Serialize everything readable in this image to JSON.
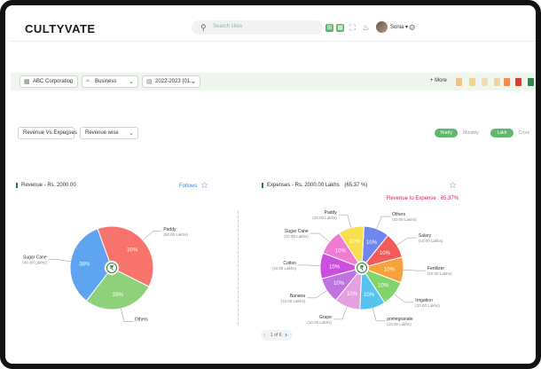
{
  "header": {
    "logo": "CULTYVATE",
    "search_placeholder": "Search sites",
    "user_name": "Sonia"
  },
  "filters": {
    "company": "ABC Corporation",
    "business": "Business",
    "year": "2022-2023 (01...",
    "more": "+ More"
  },
  "controls": {
    "chart_select": "Revenue Vs Expenses",
    "view_select": "Revenue wise",
    "period_active": "Yearly",
    "period_other": "Monthly",
    "unit_active": "Lakh",
    "unit_other": "Crore"
  },
  "revenue_panel": {
    "title": "Revenue - Rs. 2000.00",
    "follows": "Follows"
  },
  "expense_panel": {
    "title": "Expenses - Rs. 2000.00 Lakhs",
    "percent": "(65.37 %)",
    "ratio": "Revenue to Expense : 65.37%"
  },
  "pager": {
    "text": "1 of 6"
  },
  "chart_data": [
    {
      "type": "pie",
      "title": "Revenue - Rs. 2000.00",
      "slices": [
        {
          "label": "Paddy",
          "sub": "(50.00 Lakhs)",
          "value": 38,
          "pct": "38%",
          "color": "#f8736b"
        },
        {
          "label": "Others",
          "sub": "(50.00 Lakhs)",
          "value": 28,
          "pct": "28%",
          "color": "#8fd17b"
        },
        {
          "label": "Sugar Cane",
          "sub": "(40.00 Lakhs)",
          "value": 34,
          "pct": "38%",
          "color": "#5ea4f0"
        }
      ]
    },
    {
      "type": "pie",
      "title": "Expenses - Rs. 2000.00 Lakhs",
      "slices": [
        {
          "label": "Others",
          "sub": "(10.00 Lakhs)",
          "value": 10,
          "pct": "10%",
          "color": "#6f86ee"
        },
        {
          "label": "Salary",
          "sub": "(10.00 Lakhs)",
          "value": 10,
          "pct": "10%",
          "color": "#f35b5b"
        },
        {
          "label": "Fertilizer",
          "sub": "(10.00 Lakhs)",
          "value": 10,
          "pct": "10%",
          "color": "#f7a13c"
        },
        {
          "label": "Irrigation",
          "sub": "(10.00 Lakhs)",
          "value": 10,
          "pct": "10%",
          "color": "#83d36d"
        },
        {
          "label": "pomegranate",
          "sub": "(10.00 Lakhs)",
          "value": 10,
          "pct": "10%",
          "color": "#57c3ef"
        },
        {
          "label": "Grape",
          "sub": "(10.00 Lakhs)",
          "value": 10,
          "pct": "10%",
          "color": "#e5a0e0"
        },
        {
          "label": "Banana",
          "sub": "(10.00 Lakhs)",
          "value": 10,
          "pct": "10%",
          "color": "#c072e0"
        },
        {
          "label": "Cotton",
          "sub": "(10.00 Lakhs)",
          "value": 10,
          "pct": "10%",
          "color": "#cc4de0"
        },
        {
          "label": "Sugar Cane",
          "sub": "(10.00 Lakhs)",
          "value": 10,
          "pct": "10%",
          "color": "#f07bd3"
        },
        {
          "label": "Paddy",
          "sub": "(10.00 Lakhs)",
          "value": 10,
          "pct": "10%",
          "color": "#f8df4f"
        }
      ]
    }
  ],
  "colors": {
    "brand_green": "#3aa35a",
    "accent_link": "#3a8bd6",
    "ratio_red": "#d1235a"
  }
}
